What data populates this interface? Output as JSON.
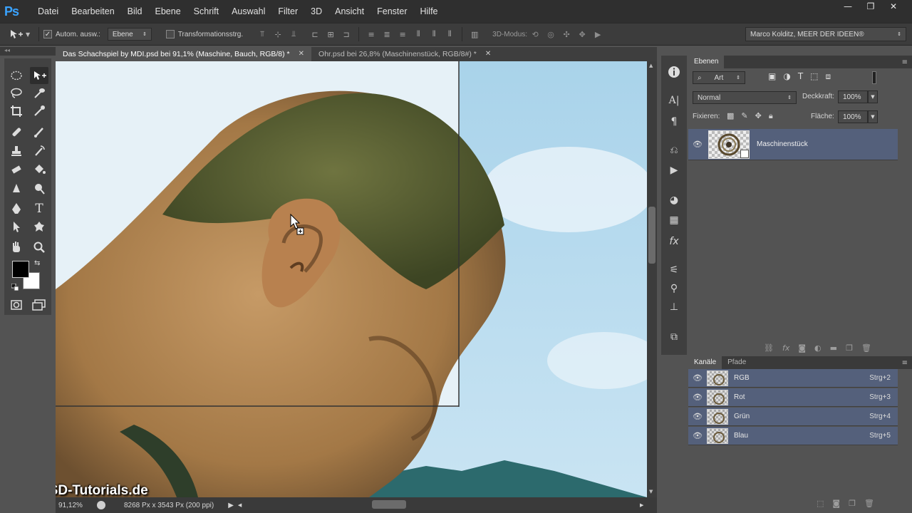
{
  "app": {
    "logo": "Ps"
  },
  "menu": [
    "Datei",
    "Bearbeiten",
    "Bild",
    "Ebene",
    "Schrift",
    "Auswahl",
    "Filter",
    "3D",
    "Ansicht",
    "Fenster",
    "Hilfe"
  ],
  "window_controls": {
    "minimize": "—",
    "maximize": "❐",
    "close": "✕"
  },
  "options": {
    "auto_select_label": "Autom. ausw.:",
    "auto_select_checked": "✓",
    "auto_select_target": "Ebene",
    "transform_label": "Transformationsstrg.",
    "mode3d_label": "3D-Modus:",
    "workspace": "Marco Kolditz, MEER DER IDEEN®"
  },
  "tabs": [
    {
      "label": "Das Schachspiel by MDI.psd bei 91,1% (Maschine, Bauch, RGB/8) *",
      "close": "✕"
    },
    {
      "label": "Ohr.psd bei 26,8% (Maschinenstück, RGB/8#) *",
      "close": "✕"
    }
  ],
  "status": {
    "zoom": "91,12%",
    "doc_size": "8268 Px x 3543 Px (200 ppi)",
    "watermark": "PSD-Tutorials.de"
  },
  "layers_panel": {
    "tab": "Ebenen",
    "filter_kind": "Art",
    "blend_mode": "Normal",
    "opacity_label": "Deckkraft:",
    "opacity_value": "100%",
    "lock_label": "Fixieren:",
    "fill_label": "Fläche:",
    "fill_value": "100%",
    "layers": [
      {
        "name": "Maschinenstück"
      }
    ]
  },
  "channels_panel": {
    "tabs": [
      "Kanäle",
      "Pfade"
    ],
    "channels": [
      {
        "name": "RGB",
        "shortcut": "Strg+2"
      },
      {
        "name": "Rot",
        "shortcut": "Strg+3"
      },
      {
        "name": "Grün",
        "shortcut": "Strg+4"
      },
      {
        "name": "Blau",
        "shortcut": "Strg+5"
      }
    ]
  },
  "colors": {
    "foreground": "#000000",
    "background": "#ffffff",
    "selected_layer": "#54607b",
    "logo_blue": "#3aa3ff"
  }
}
